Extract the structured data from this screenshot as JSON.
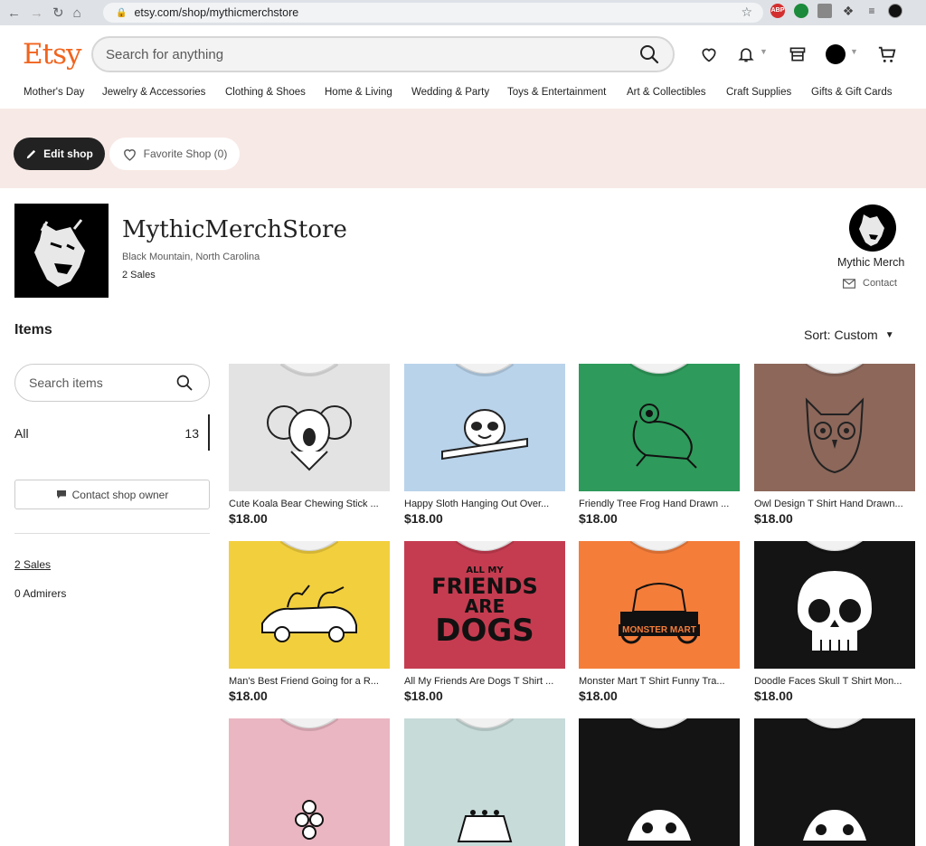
{
  "browser": {
    "url": "etsy.com/shop/mythicmerchstore",
    "extensions": [
      "ABP"
    ]
  },
  "header": {
    "logo": "Etsy",
    "search_placeholder": "Search for anything",
    "icons": [
      "heart-icon",
      "bell-icon",
      "shop-icon",
      "avatar",
      "cart-icon"
    ]
  },
  "categories": [
    "Mother's Day",
    "Jewelry & Accessories",
    "Clothing & Shoes",
    "Home & Living",
    "Wedding & Party",
    "Toys & Entertainment",
    "Art & Collectibles",
    "Craft Supplies",
    "Gifts & Gift Cards"
  ],
  "banner": {
    "edit_label": "Edit shop",
    "favorite_label": "Favorite Shop (0)",
    "color": "#f7e9e6"
  },
  "shop": {
    "name": "MythicMerchStore",
    "location": "Black Mountain, North Carolina",
    "sales": "2 Sales",
    "owner_name": "Mythic Merch",
    "contact_label": "Contact"
  },
  "items": {
    "heading": "Items",
    "sort_label": "Sort: Custom",
    "search_placeholder": "Search items",
    "all_label": "All",
    "all_count": "13",
    "contact_owner_label": "Contact shop owner",
    "sales_link": "2 Sales",
    "admirers": "0 Admirers"
  },
  "listings": [
    {
      "title": "Cute Koala Bear Chewing Stick ...",
      "price": "$18.00",
      "color": "#e3e3e3"
    },
    {
      "title": "Happy Sloth Hanging Out Over...",
      "price": "$18.00",
      "color": "#b9d3ea"
    },
    {
      "title": "Friendly Tree Frog Hand Drawn ...",
      "price": "$18.00",
      "color": "#2e9a5b"
    },
    {
      "title": "Owl Design T Shirt Hand Drawn...",
      "price": "$18.00",
      "color": "#8c675a"
    },
    {
      "title": "Man's Best Friend Going for a R...",
      "price": "$18.00",
      "color": "#f2cf3d"
    },
    {
      "title": "All My Friends Are Dogs T Shirt ...",
      "price": "$18.00",
      "color": "#c53c50",
      "art_text": [
        "ALL MY",
        "FRIENDS",
        "ARE",
        "DOGS"
      ]
    },
    {
      "title": "Monster Mart T Shirt Funny Tra...",
      "price": "$18.00",
      "color": "#f47d3a",
      "art_text": [
        "MONSTER MART"
      ]
    },
    {
      "title": "Doodle Faces Skull T Shirt Mon...",
      "price": "$18.00",
      "color": "#141414"
    },
    {
      "title": "",
      "price": "",
      "color": "#eab6c2"
    },
    {
      "title": "",
      "price": "",
      "color": "#c7dbd9"
    },
    {
      "title": "",
      "price": "",
      "color": "#141414"
    },
    {
      "title": "",
      "price": "",
      "color": "#141414"
    }
  ]
}
